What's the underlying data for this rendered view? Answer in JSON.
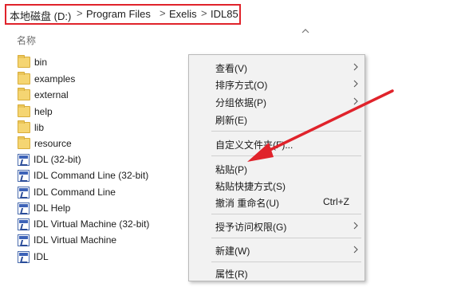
{
  "address_bar": {
    "crumbs": [
      "本地磁盘 (D:)",
      "Program Files",
      "Exelis",
      "IDL85"
    ],
    "separator": ">",
    "highlight_color": "#e0232b"
  },
  "file_list": {
    "column_header": "名称",
    "items": [
      {
        "name": "bin",
        "type": "folder"
      },
      {
        "name": "examples",
        "type": "folder"
      },
      {
        "name": "external",
        "type": "folder"
      },
      {
        "name": "help",
        "type": "folder"
      },
      {
        "name": "lib",
        "type": "folder"
      },
      {
        "name": "resource",
        "type": "folder"
      },
      {
        "name": "IDL (32-bit)",
        "type": "shortcut"
      },
      {
        "name": "IDL Command Line (32-bit)",
        "type": "shortcut"
      },
      {
        "name": "IDL Command Line",
        "type": "shortcut"
      },
      {
        "name": "IDL Help",
        "type": "shortcut"
      },
      {
        "name": "IDL Virtual Machine (32-bit)",
        "type": "shortcut"
      },
      {
        "name": "IDL Virtual Machine",
        "type": "shortcut"
      },
      {
        "name": "IDL",
        "type": "shortcut"
      }
    ]
  },
  "context_menu": {
    "items": [
      {
        "label": "查看(V)",
        "submenu": true
      },
      {
        "label": "排序方式(O)",
        "submenu": true
      },
      {
        "label": "分组依据(P)",
        "submenu": true
      },
      {
        "label": "刷新(E)"
      },
      {
        "label": "自定义文件夹(F)..."
      },
      {
        "label": "粘贴(P)"
      },
      {
        "label": "粘贴快捷方式(S)"
      },
      {
        "label": "撤消 重命名(U)",
        "shortcut": "Ctrl+Z"
      },
      {
        "label": "授予访问权限(G)",
        "submenu": true
      },
      {
        "label": "新建(W)",
        "submenu": true
      },
      {
        "label": "属性(R)"
      }
    ]
  },
  "annotation": {
    "arrow_color": "#e0232b"
  }
}
